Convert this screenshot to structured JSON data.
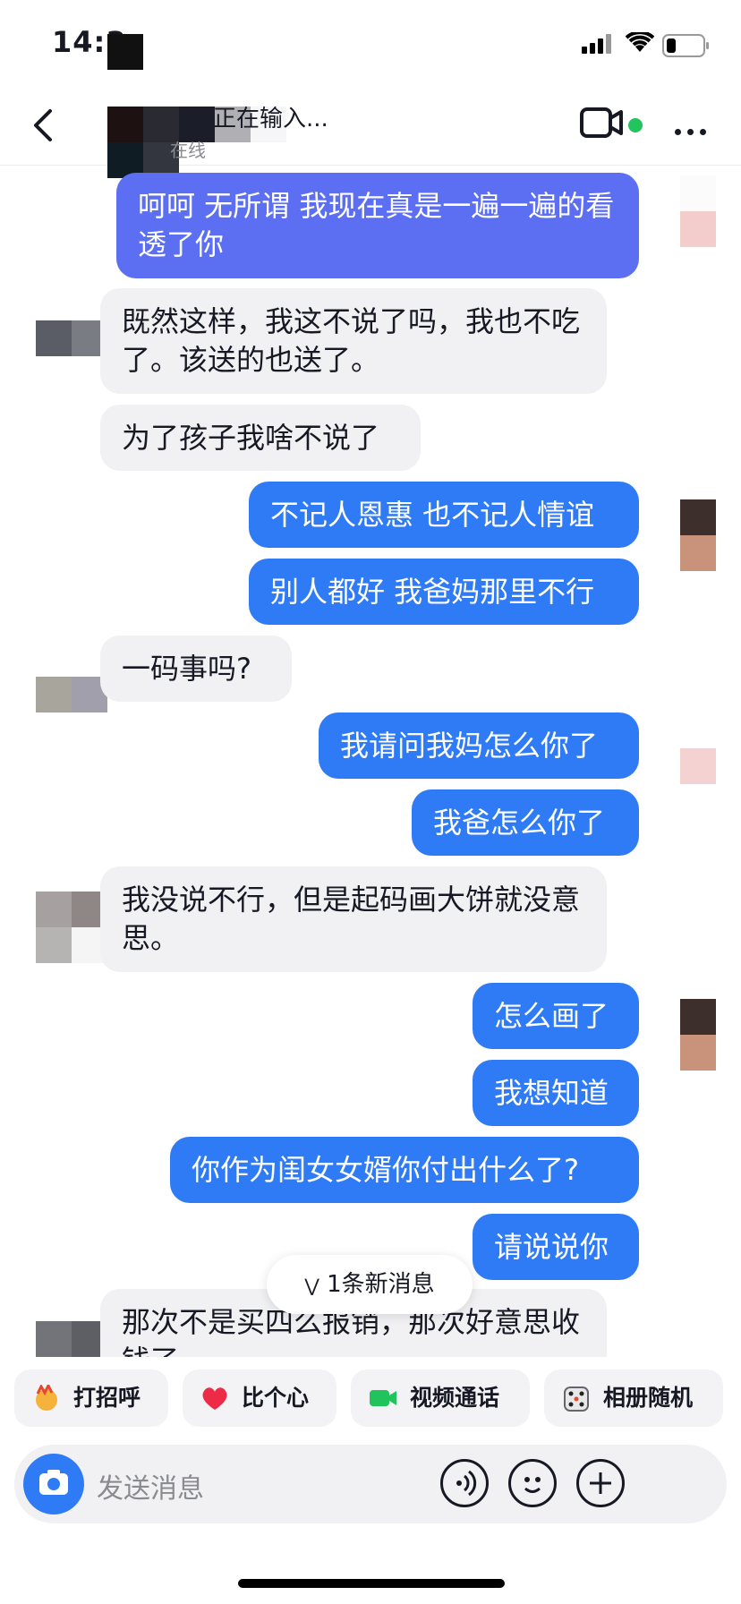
{
  "status": {
    "time": "14:3"
  },
  "header": {
    "title": "正在输入...",
    "subtitle": "在线"
  },
  "messages": [
    {
      "dir": "out",
      "text": "呵呵 无所谓 我现在真是一遍一遍的看透了你"
    },
    {
      "dir": "in",
      "text": "既然这样，我这不说了吗，我也不吃了。该送的也送了。"
    },
    {
      "dir": "in",
      "text": "为了孩子我啥不说了"
    },
    {
      "dir": "out",
      "text": "不记人恩惠 也不记人情谊"
    },
    {
      "dir": "out",
      "text": "别人都好 我爸妈那里不行"
    },
    {
      "dir": "in",
      "text": "一码事吗?"
    },
    {
      "dir": "out",
      "text": "我请问我妈怎么你了"
    },
    {
      "dir": "out",
      "text": "我爸怎么你了"
    },
    {
      "dir": "in",
      "text": "我没说不行，但是起码画大饼就没意思。"
    },
    {
      "dir": "out",
      "text": "怎么画了"
    },
    {
      "dir": "out",
      "text": "我想知道"
    },
    {
      "dir": "out",
      "text": "你作为闺女女婿你付出什么了?"
    },
    {
      "dir": "out",
      "text": "请说说你"
    },
    {
      "dir": "in",
      "text": "那次不是买四么报销，那次好意思收钱了"
    }
  ],
  "new_message_pill": "1条新消息",
  "quick_replies": [
    {
      "label": "打招呼",
      "icon": "wave-icon"
    },
    {
      "label": "比个心",
      "icon": "heart-icon"
    },
    {
      "label": "视频通话",
      "icon": "video-call-icon"
    },
    {
      "label": "相册随机",
      "icon": "dice-icon"
    }
  ],
  "input": {
    "placeholder": "发送消息"
  },
  "colors": {
    "accent": "#2f7bf5",
    "purple_bubble": "#5c6ff3",
    "online": "#22c45e"
  }
}
